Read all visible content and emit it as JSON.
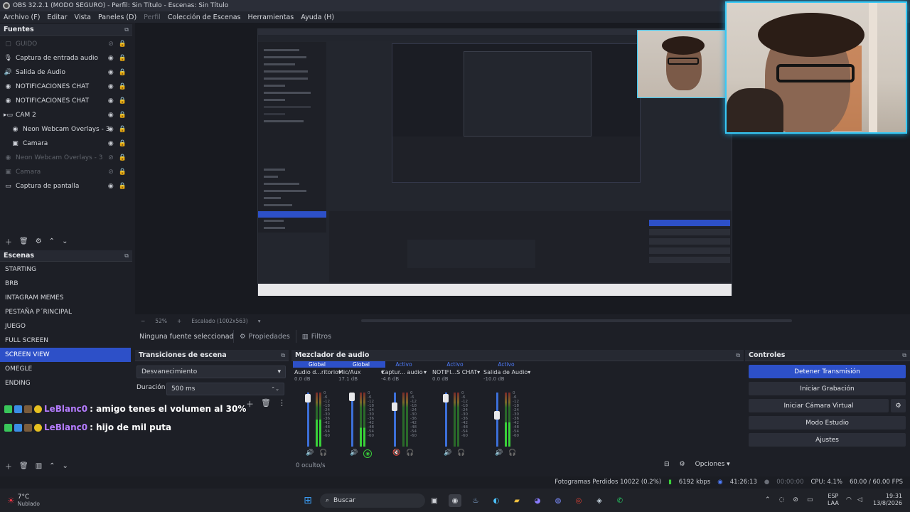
{
  "window": {
    "title": "OBS 32.2.1 (MODO SEGURO) - Perfil: Sin Título - Escenas: Sin Título"
  },
  "menu": [
    "Archivo (F)",
    "Editar",
    "Vista",
    "Paneles (D)",
    "Perfil",
    "Colección de Escenas",
    "Herramientas",
    "Ayuda (H)"
  ],
  "sources": {
    "title": "Fuentes",
    "items": [
      {
        "label": "GUIDO",
        "icon": "group-icon",
        "dim": true
      },
      {
        "label": "Captura de entrada audio",
        "icon": "microphone-icon",
        "dim": false
      },
      {
        "label": "Salida de Audio",
        "icon": "speaker-icon",
        "dim": false
      },
      {
        "label": "NOTIFICACIONES CHAT",
        "icon": "browser-icon",
        "dim": false
      },
      {
        "label": "NOTIFICACIONES CHAT",
        "icon": "browser-icon",
        "dim": false
      },
      {
        "label": "CAM 2",
        "icon": "folder-icon",
        "dim": false
      },
      {
        "label": "Neon Webcam Overlays - 3",
        "icon": "browser-icon",
        "dim": false
      },
      {
        "label": "Camara",
        "icon": "camera-icon",
        "dim": false
      },
      {
        "label": "Neon Webcam Overlays - 3",
        "icon": "browser-icon",
        "dim": true
      },
      {
        "label": "Camara",
        "icon": "camera-icon",
        "dim": true
      },
      {
        "label": "Captura de pantalla",
        "icon": "monitor-icon",
        "dim": false
      }
    ]
  },
  "scenes": {
    "title": "Escenas",
    "items": [
      "STARTING",
      "BRB",
      "INTAGRAM MEMES",
      "PESTAÑA P´RINCIPAL",
      "JUEGO",
      "FULL SCREEN",
      "SCREEN VIEW",
      "OMEGLE",
      "ENDING"
    ],
    "active_index": 6
  },
  "preview": {
    "zoom": "52%",
    "scale_label": "Escalado (1002x563)"
  },
  "propbar": {
    "selection": "Ninguna fuente seleccionada",
    "properties": "Propiedades",
    "filters": "Filtros"
  },
  "transitions": {
    "title": "Transiciones de escena",
    "selected": "Desvanecimiento",
    "duration_label": "Duración",
    "duration_value": "500 ms"
  },
  "chat": [
    {
      "user": "LeBlanc0",
      "message": ": amigo tenes el volumen al 30%"
    },
    {
      "user": "LeBlanc0",
      "message": ": hijo de mil puta"
    }
  ],
  "mixer": {
    "title": "Mezclador de audio",
    "hidden": "0 oculto/s",
    "options": "Opciones",
    "scale": [
      "0",
      "-6",
      "-12",
      "-18",
      "-24",
      "-30",
      "-36",
      "-42",
      "-48",
      "-54",
      "-60"
    ],
    "strips": [
      {
        "tag": "Global",
        "name": "Audio d...ritorio",
        "db": "0.0 dB",
        "muted": false,
        "level": 0.5
      },
      {
        "tag": "Global",
        "name": "Mic/Aux",
        "db": "17.1 dB",
        "muted": false,
        "level": 0.35
      },
      {
        "tag": "Activo",
        "name": "Captur... audio",
        "db": "-4.6 dB",
        "muted": true,
        "level": 0.0
      },
      {
        "tag": "Activo",
        "name": "NOTIFI...S CHAT",
        "db": "0.0 dB",
        "muted": false,
        "level": 0.0
      },
      {
        "tag": "Activo",
        "name": "Salida de Audio",
        "db": "-10.0 dB",
        "muted": false,
        "level": 0.45
      }
    ]
  },
  "controls": {
    "title": "Controles",
    "stop_stream": "Detener Transmisión",
    "start_record": "Iniciar Grabación",
    "virtual_cam": "Iniciar Cámara Virtual",
    "studio_mode": "Modo Estudio",
    "settings": "Ajustes"
  },
  "status": {
    "dropped": "Fotogramas Perdidos 10022 (0.2%)",
    "bitrate": "6192 kbps",
    "stream_time": "41:26:13",
    "record_time": "00:00:00",
    "cpu": "CPU: 4.1%",
    "fps": "60.00 / 60.00 FPS"
  },
  "taskbar": {
    "weather_temp": "7°C",
    "weather_desc": "Nublado",
    "search": "Buscar",
    "lang": "ESP",
    "lang2": "LAA",
    "time": "19:31",
    "date": "13/8/2026"
  },
  "colors": {
    "accent": "#2d50c8",
    "meter_green": "#39d139",
    "webcam_border": "#38c9f5"
  }
}
